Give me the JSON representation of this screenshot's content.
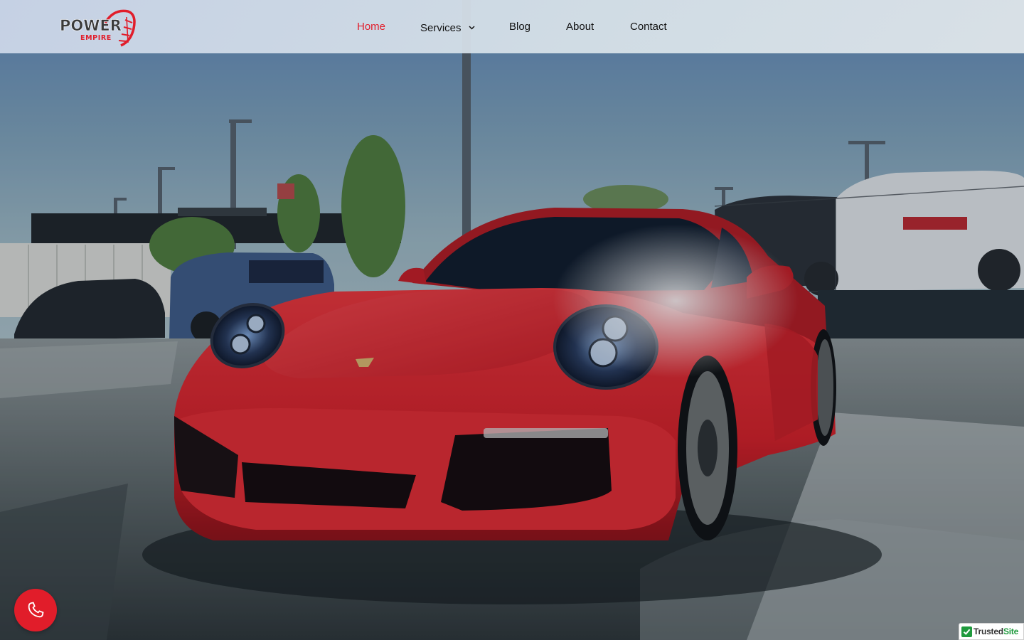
{
  "brand": {
    "logo_word": "POWER",
    "logo_sub": "EMPIRE",
    "accent_color": "#e11d2a"
  },
  "nav": {
    "items": [
      {
        "label": "Home",
        "active": true
      },
      {
        "label": "Services",
        "has_dropdown": true
      },
      {
        "label": "Blog"
      },
      {
        "label": "About"
      },
      {
        "label": "Contact"
      }
    ]
  },
  "hero": {
    "image_subject": "red sports car parked in a lot",
    "car_color": "#e0232c"
  },
  "floating": {
    "call_icon": "phone-icon",
    "badge_part1": "Trusted",
    "badge_part2": "Site"
  }
}
